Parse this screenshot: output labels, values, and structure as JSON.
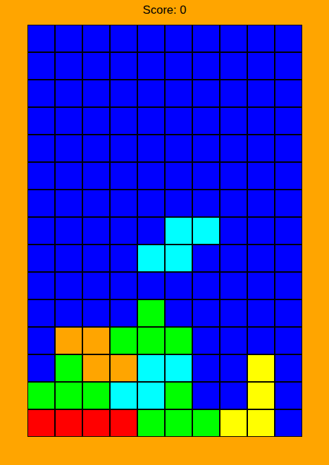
{
  "score": {
    "text": "Score: 0"
  },
  "board": {
    "rows": [
      [
        "#0000ff",
        "#0000ff",
        "#0000ff",
        "#0000ff",
        "#0000ff",
        "#0000ff",
        "#0000ff",
        "#0000ff",
        "#0000ff",
        "#0000ff"
      ],
      [
        "#0000ff",
        "#0000ff",
        "#0000ff",
        "#0000ff",
        "#0000ff",
        "#0000ff",
        "#0000ff",
        "#0000ff",
        "#0000ff",
        "#0000ff"
      ],
      [
        "#0000ff",
        "#0000ff",
        "#0000ff",
        "#0000ff",
        "#0000ff",
        "#0000ff",
        "#0000ff",
        "#0000ff",
        "#0000ff",
        "#0000ff"
      ],
      [
        "#0000ff",
        "#0000ff",
        "#0000ff",
        "#0000ff",
        "#0000ff",
        "#0000ff",
        "#0000ff",
        "#0000ff",
        "#0000ff",
        "#0000ff"
      ],
      [
        "#0000ff",
        "#0000ff",
        "#0000ff",
        "#0000ff",
        "#0000ff",
        "#0000ff",
        "#0000ff",
        "#0000ff",
        "#0000ff",
        "#0000ff"
      ],
      [
        "#0000ff",
        "#0000ff",
        "#0000ff",
        "#0000ff",
        "#0000ff",
        "#0000ff",
        "#0000ff",
        "#0000ff",
        "#0000ff",
        "#0000ff"
      ],
      [
        "#0000ff",
        "#0000ff",
        "#0000ff",
        "#0000ff",
        "#0000ff",
        "#0000ff",
        "#0000ff",
        "#0000ff",
        "#0000ff",
        "#0000ff"
      ],
      [
        "#0000ff",
        "#0000ff",
        "#0000ff",
        "#0000ff",
        "#0000ff",
        "#00ffff",
        "#00ffff",
        "#0000ff",
        "#0000ff",
        "#0000ff"
      ],
      [
        "#0000ff",
        "#0000ff",
        "#0000ff",
        "#0000ff",
        "#00ffff",
        "#00ffff",
        "#0000ff",
        "#0000ff",
        "#0000ff",
        "#0000ff"
      ],
      [
        "#0000ff",
        "#0000ff",
        "#0000ff",
        "#0000ff",
        "#0000ff",
        "#0000ff",
        "#0000ff",
        "#0000ff",
        "#0000ff",
        "#0000ff"
      ],
      [
        "#0000ff",
        "#0000ff",
        "#0000ff",
        "#0000ff",
        "#00ff00",
        "#0000ff",
        "#0000ff",
        "#0000ff",
        "#0000ff",
        "#0000ff"
      ],
      [
        "#0000ff",
        "#ffa500",
        "#ffa500",
        "#00ff00",
        "#00ff00",
        "#00ff00",
        "#0000ff",
        "#0000ff",
        "#0000ff",
        "#0000ff"
      ],
      [
        "#0000ff",
        "#00ff00",
        "#ffa500",
        "#ffa500",
        "#00ffff",
        "#00ffff",
        "#0000ff",
        "#0000ff",
        "#ffff00",
        "#0000ff"
      ],
      [
        "#00ff00",
        "#00ff00",
        "#00ff00",
        "#00ffff",
        "#00ffff",
        "#00ff00",
        "#0000ff",
        "#0000ff",
        "#ffff00",
        "#0000ff"
      ],
      [
        "#ff0000",
        "#ff0000",
        "#ff0000",
        "#ff0000",
        "#00ff00",
        "#00ff00",
        "#00ff00",
        "#ffff00",
        "#ffff00",
        "#0000ff"
      ]
    ]
  }
}
